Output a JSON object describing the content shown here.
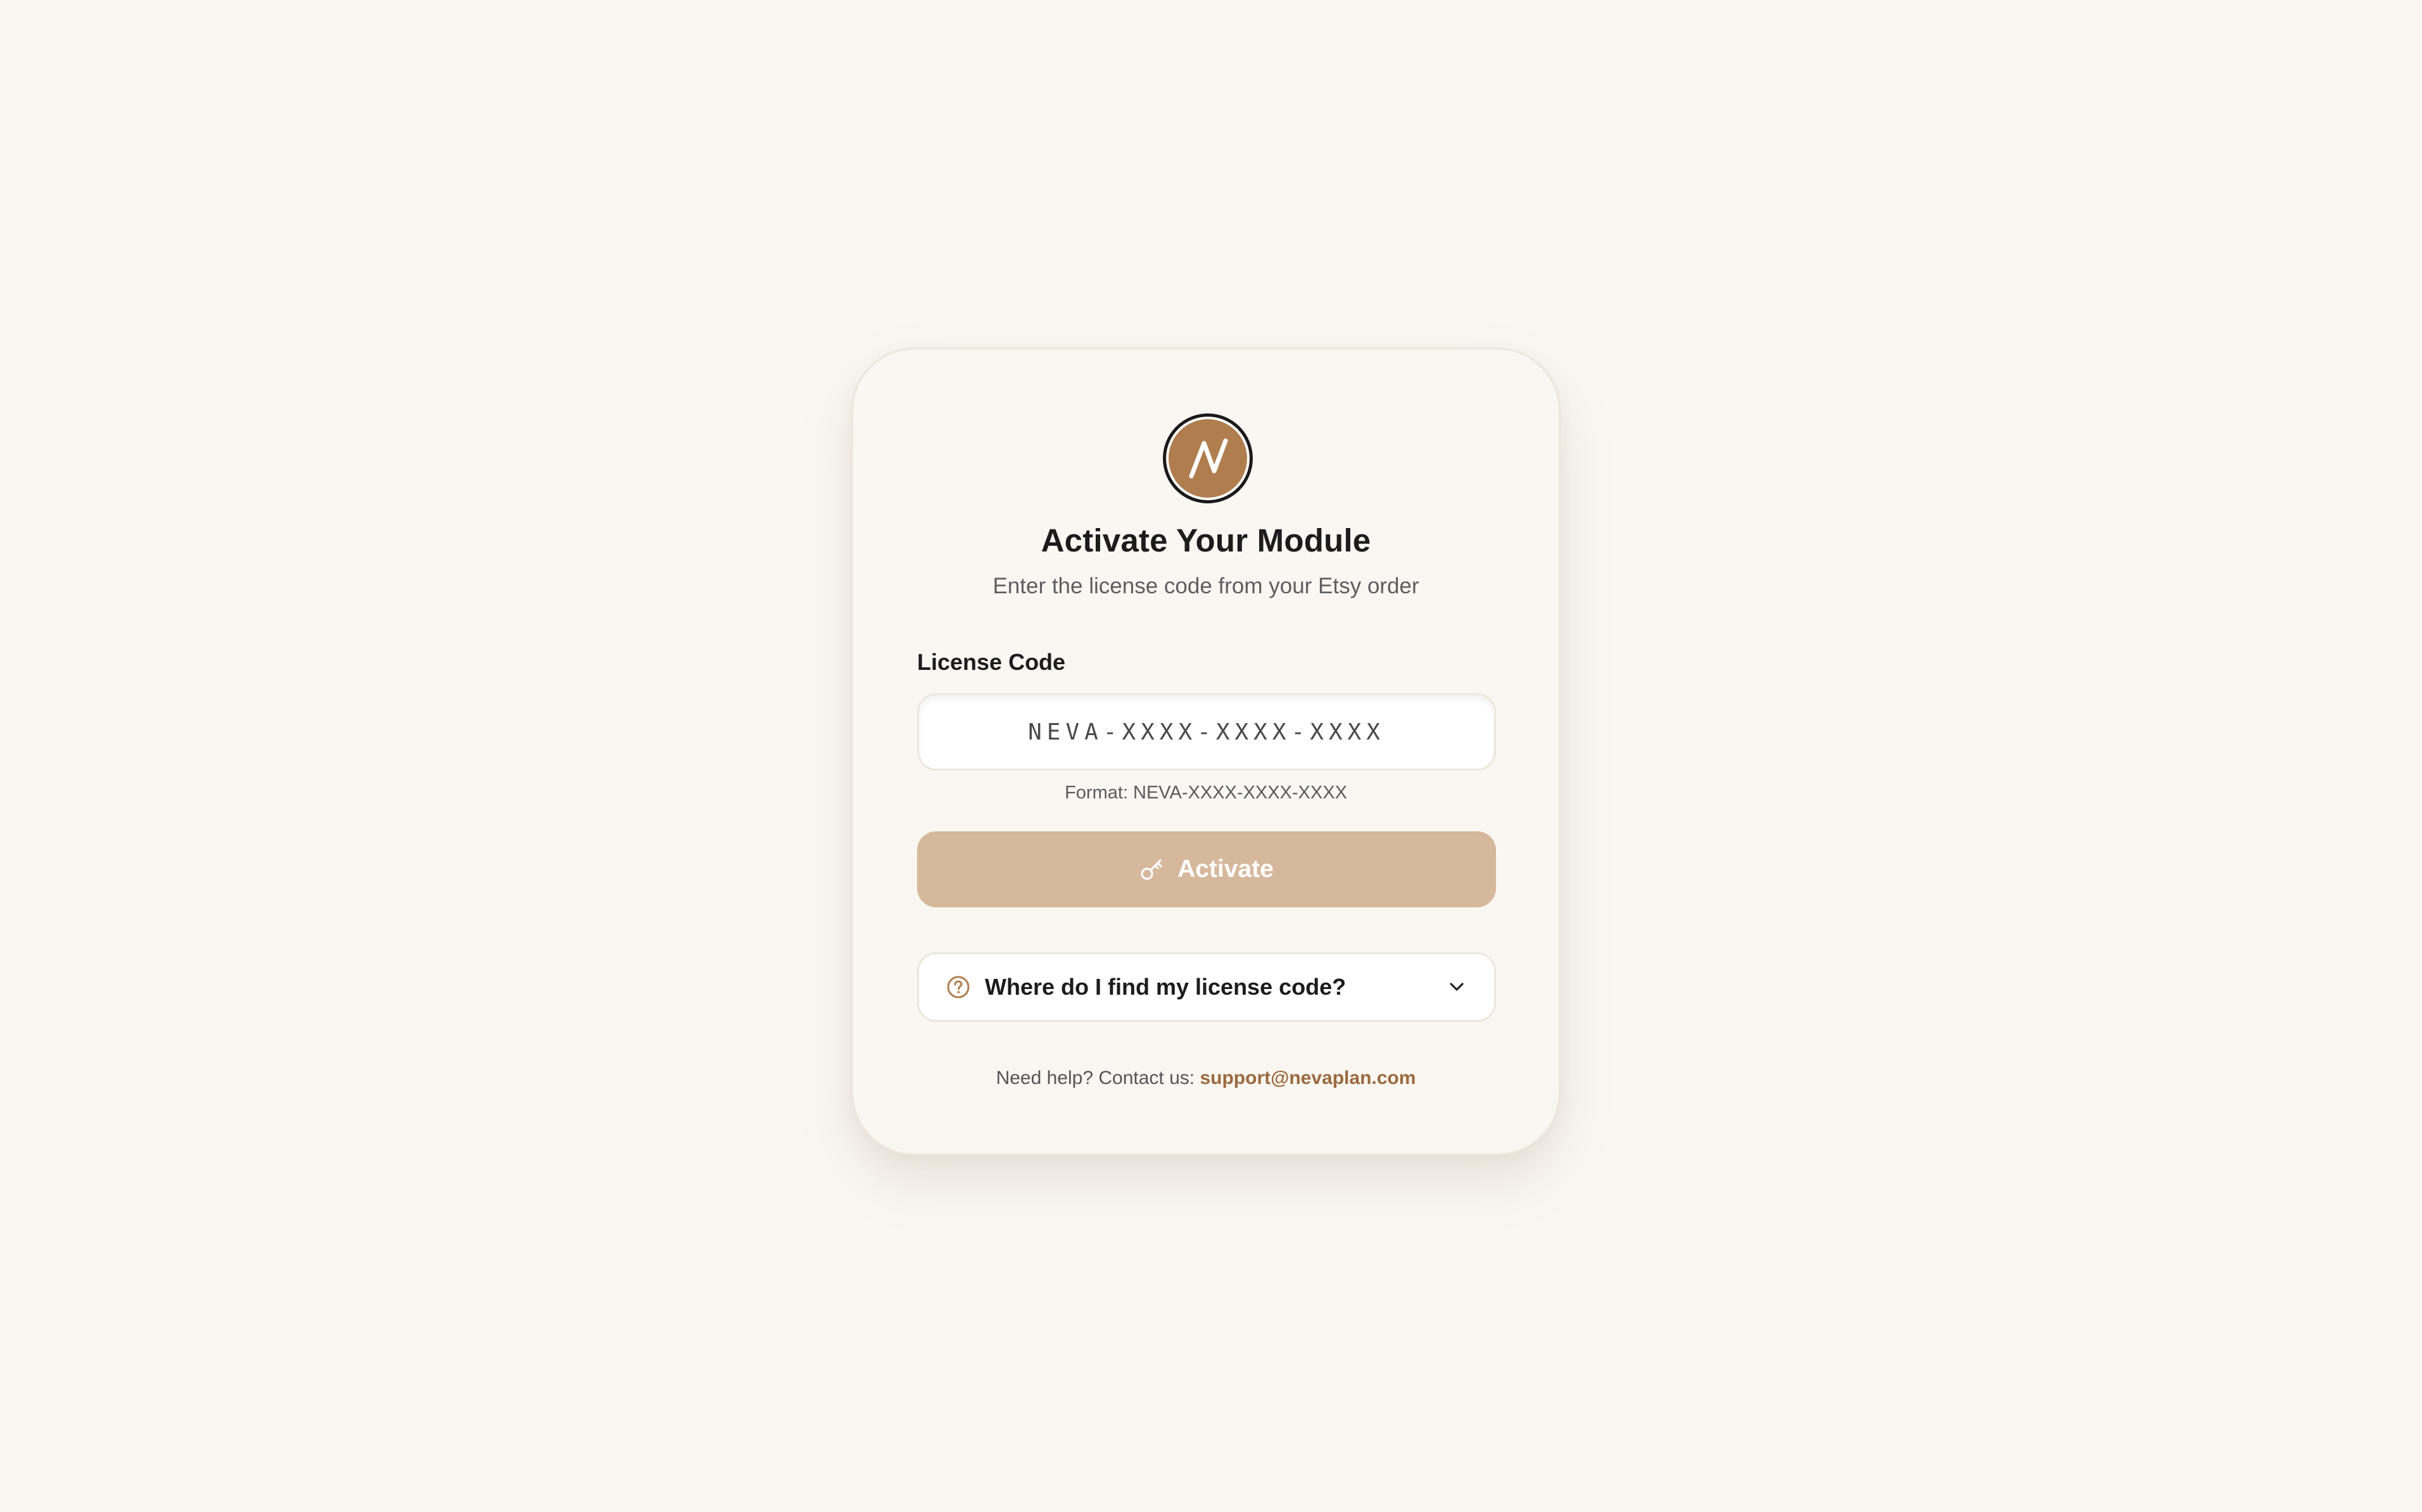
{
  "colors": {
    "background": "#faf7f2",
    "card": "#faf7f2",
    "accent": "#b07e4e",
    "button_disabled": "#d6b89c",
    "link": "#9a6a3e",
    "text_primary": "#1c1c1c",
    "text_secondary": "#5e5e5e"
  },
  "logo": {
    "icon": "brand-n-logo"
  },
  "header": {
    "title": "Activate Your Module",
    "subtitle": "Enter the license code from your Etsy order"
  },
  "license": {
    "label": "License Code",
    "placeholder": "NEVA-XXXX-XXXX-XXXX",
    "value": "",
    "format_hint": "Format: NEVA-XXXX-XXXX-XXXX"
  },
  "activate_button": {
    "label": "Activate",
    "icon": "key-icon",
    "state": "disabled"
  },
  "faq": {
    "question": "Where do I find my license code?",
    "icon": "question-circle-icon",
    "expanded": false
  },
  "footer": {
    "help_text": "Need help? Contact us:",
    "email": "support@nevaplan.com"
  }
}
